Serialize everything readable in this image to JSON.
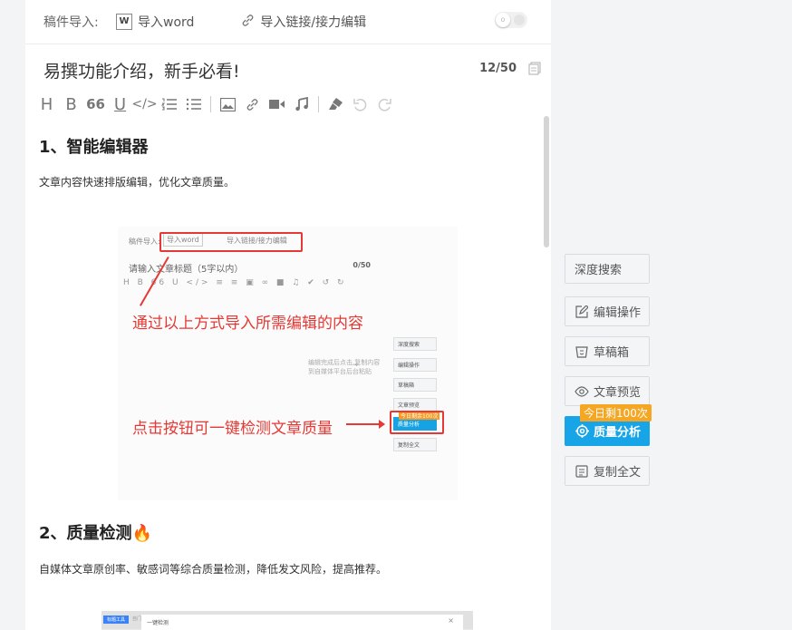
{
  "import_bar": {
    "label": "稿件导入:",
    "word_icon": "W",
    "word_button": "导入word",
    "link_button": "导入链接/接力编辑"
  },
  "title": {
    "text": "易撰功能介绍，新手必看!",
    "counter": "12/50"
  },
  "toolbar": {
    "items": [
      "heading-icon",
      "bold-icon",
      "quote-icon",
      "underline-icon",
      "code-icon",
      "ordered-list-icon",
      "unordered-list-icon",
      "image-icon",
      "link-icon",
      "video-icon",
      "music-icon",
      "clear-format-icon",
      "undo-icon",
      "redo-icon"
    ],
    "heading": "H",
    "bold": "B",
    "quote": "66",
    "underline": "U",
    "code": "</>"
  },
  "content": {
    "section1_title": "1、智能编辑器",
    "section1_text": "文章内容快速排版编辑，优化文章质量。",
    "section2_title": "2、质量检测",
    "section2_text": "自媒体文章原创率、敏感词等综合质量检测，降低发文风险，提高推荐。",
    "section2_emoji": "🔥"
  },
  "screenshot1": {
    "import_label": "稿件导入:",
    "word_button": "导入word",
    "link_button": "导入链接/接力编辑",
    "title_placeholder": "请输入文章标题（5字以内）",
    "counter": "0/50",
    "tools": "H B 66 U </> ≡ ≡ ▣ ∞ ■ ♫ ✔ ↺ ↻",
    "note1": "通过以上方式导入所需编辑的内容",
    "note2": "点击按钮可一键检测文章质量",
    "gray_note": "编辑完成后点击 复制内容到自媒体平台后台粘贴",
    "gray_arrow": "→",
    "mini_buttons": [
      "深度搜索",
      "编辑操作",
      "草稿箱",
      "文章预览",
      "质量分析",
      "复制全文"
    ],
    "mini_badge": "今日剩余100次"
  },
  "screenshot2": {
    "tab1": "标题工具",
    "tab2": "自门",
    "dialog_title": "一键检测",
    "close": "×"
  },
  "sidebar": {
    "deep_search": "深度搜索",
    "edit_ops": "编辑操作",
    "drafts": "草稿箱",
    "preview": "文章预览",
    "quality": "质量分析",
    "quality_badge": "今日剩100次",
    "copy_all": "复制全文"
  },
  "colors": {
    "accent_blue": "#18a5e8",
    "badge_orange": "#f5a623",
    "annotation_red": "#e53935"
  }
}
